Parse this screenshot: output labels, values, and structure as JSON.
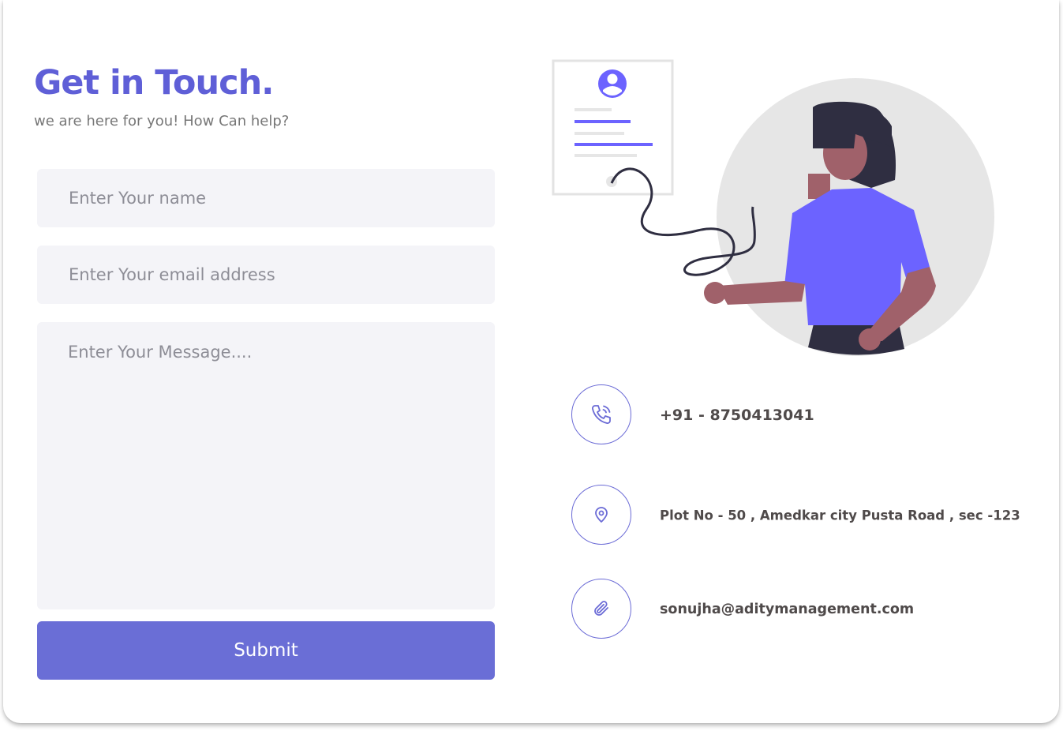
{
  "header": {
    "title": "Get in Touch.",
    "subtitle": "we are here for you! How Can help?"
  },
  "form": {
    "name_placeholder": "Enter Your name",
    "email_placeholder": "Enter Your email address",
    "message_placeholder": "Enter Your Message....",
    "submit_label": "Submit"
  },
  "contact": {
    "phone": "+91 - 8750413041",
    "address": "Plot No - 50 , Amedkar city Pusta Road , sec -123",
    "email": "sonujha@aditymanagement.com"
  },
  "icons": {
    "phone": "phone-icon",
    "location": "map-pin-icon",
    "attachment": "paperclip-icon",
    "illustration": "woman-with-contact-card"
  },
  "colors": {
    "accent": "#5f5fd7",
    "button": "#6a6ed6",
    "field_bg": "#f4f4f8",
    "illustration_purple": "#6c63ff",
    "circle_bg": "#e6e6e6"
  }
}
